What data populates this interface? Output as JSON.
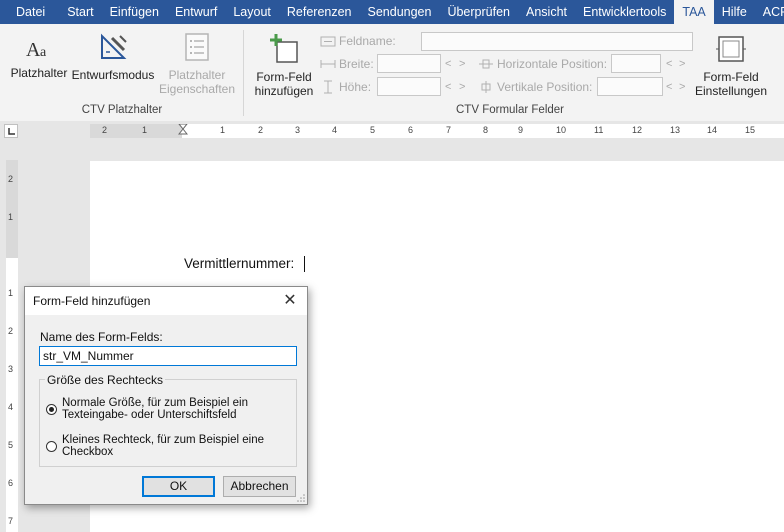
{
  "menubar": {
    "items": [
      {
        "label": "Datei"
      },
      {
        "label": "Start"
      },
      {
        "label": "Einfügen"
      },
      {
        "label": "Entwurf"
      },
      {
        "label": "Layout"
      },
      {
        "label": "Referenzen"
      },
      {
        "label": "Sendungen"
      },
      {
        "label": "Überprüfen"
      },
      {
        "label": "Ansicht"
      },
      {
        "label": "Entwicklertools"
      },
      {
        "label": "TAA"
      },
      {
        "label": "Hilfe"
      },
      {
        "label": "ACROBAT"
      }
    ],
    "active": "TAA",
    "accent": "#2b579a"
  },
  "ribbon": {
    "group1": {
      "label": "CTV Platzhalter",
      "platzhalter": "Platzhalter",
      "entwurfsmodus": "Entwurfsmodus",
      "eigenschaften_line1": "Platzhalter",
      "eigenschaften_line2": "Eigenschaften"
    },
    "group2": {
      "label": "CTV Formular Felder",
      "add_line1": "Form-Feld",
      "add_line2": "hinzufügen",
      "feldname": "Feldname:",
      "breite": "Breite:",
      "hoehe": "Höhe:",
      "hpos": "Horizontale Position:",
      "vpos": "Vertikale Position:",
      "arrow_left": "<",
      "arrow_right": ">",
      "settings_line1": "Form-Feld",
      "settings_line2": "Einstellungen"
    }
  },
  "ruler": {
    "h_ticks": [
      "2",
      "1",
      "1",
      "2",
      "3",
      "4",
      "5",
      "6",
      "7",
      "8",
      "9",
      "10",
      "11",
      "12",
      "13",
      "14",
      "15"
    ],
    "v_ticks": [
      "2",
      "1",
      "1",
      "2",
      "3",
      "4",
      "5",
      "6",
      "7"
    ]
  },
  "document": {
    "text": "Vermittlernummer:"
  },
  "dialog": {
    "title": "Form-Feld hinzufügen",
    "close": "✕",
    "name_label": "Name des Form-Felds:",
    "name_value": "str_VM_Nummer",
    "group_label": "Größe des Rechtecks",
    "option1_line1": "Normale Größe, für zum Beispiel ein",
    "option1_line2": "Texteingabe- oder Unterschiftsfeld",
    "option2_line1": "Kleines Rechteck, für zum Beispiel eine",
    "option2_line2": "Checkbox",
    "ok": "OK",
    "cancel": "Abbrechen"
  }
}
